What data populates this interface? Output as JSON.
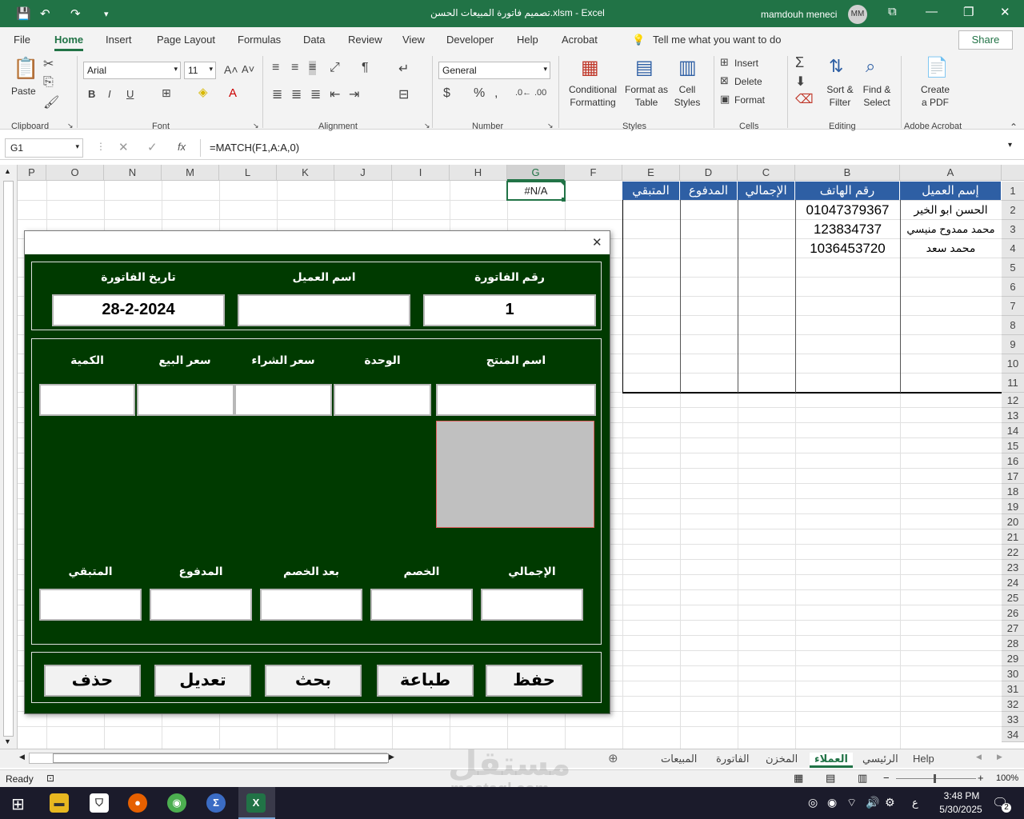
{
  "window": {
    "title": "تصميم فاتورة المبيعات الحسن.xlsm  -  Excel",
    "user": "mamdouh meneci",
    "avatar": "MM"
  },
  "menu": {
    "tabs": [
      "File",
      "Home",
      "Insert",
      "Page Layout",
      "Formulas",
      "Data",
      "Review",
      "View",
      "Developer",
      "Help",
      "Acrobat"
    ],
    "tell_me": "Tell me what you want to do",
    "share": "Share"
  },
  "ribbon": {
    "paste": "Paste",
    "clipboard": "Clipboard",
    "font_name": "Arial",
    "font_size": "11",
    "font": "Font",
    "alignment": "Alignment",
    "number_format": "General",
    "number": "Number",
    "conditional_formatting": "Conditional Formatting",
    "format_as_table": "Format as Table",
    "cell_styles": "Cell Styles",
    "styles": "Styles",
    "insert": "Insert",
    "delete": "Delete",
    "format": "Format",
    "cells": "Cells",
    "sort_filter": "Sort & Filter",
    "find_select": "Find & Select",
    "editing": "Editing",
    "create_pdf": "Create a PDF",
    "adobe_acrobat": "Adobe Acrobat"
  },
  "formula_bar": {
    "name_box": "G1",
    "fx": "fx",
    "formula": "=MATCH(F1,A:A,0)"
  },
  "sheet": {
    "columns": [
      "P",
      "O",
      "N",
      "M",
      "L",
      "K",
      "J",
      "I",
      "H",
      "G",
      "F",
      "E",
      "D",
      "C",
      "B",
      "A"
    ],
    "rows": [
      "1",
      "2",
      "3",
      "4",
      "5",
      "6",
      "7",
      "8",
      "9",
      "10",
      "11",
      "12",
      "13",
      "14",
      "15",
      "16",
      "17",
      "18",
      "19",
      "20",
      "21",
      "22",
      "23",
      "24",
      "25",
      "26",
      "27",
      "28",
      "29",
      "30",
      "31",
      "32",
      "33",
      "34"
    ],
    "g1_value": "#N/A",
    "table_headers": [
      "المتبقي",
      "المدفوع",
      "الإجمالي",
      "رقم الهاتف",
      "إسم العميل"
    ],
    "table_rows": [
      {
        "phone": "01047379367",
        "name": "الحسن ابو الخير"
      },
      {
        "phone": "123834737",
        "name": "محمد ممدوح منيسي"
      },
      {
        "phone": "1036453720",
        "name": "محمد سعد"
      }
    ]
  },
  "dialog": {
    "close": "✕",
    "labels": {
      "invoice_no": "رقم الفاتورة",
      "customer_name": "اسم العميل",
      "invoice_date": "تاريخ الفاتورة",
      "product_name": "اسم المنتج",
      "unit": "الوحدة",
      "purchase_price": "سعر الشراء",
      "sale_price": "سعر البيع",
      "quantity": "الكمية",
      "total": "الإجمالي",
      "discount": "الخصم",
      "after_discount": "بعد الخصم",
      "paid": "المدفوع",
      "remaining": "المتبقي"
    },
    "values": {
      "invoice_no": "1",
      "customer_name": "",
      "invoice_date": "28-2-2024"
    },
    "buttons": {
      "save": "حفظ",
      "print": "طباعة",
      "search": "بحث",
      "edit": "تعديل",
      "delete": "حذف"
    }
  },
  "sheet_tabs": [
    "Help",
    "الرئيسي",
    "العملاء",
    "المخزن",
    "الفاتورة",
    "المبيعات"
  ],
  "active_sheet": "العملاء",
  "status": {
    "ready": "Ready",
    "zoom": "100%"
  },
  "taskbar": {
    "time": "3:48 PM",
    "date": "5/30/2025",
    "lang": "ع",
    "notifications": "2"
  },
  "watermark": {
    "text": "مستقل",
    "site": "mostaql.com"
  },
  "colors": {
    "excel_green": "#217346",
    "dialog_bg": "#003a00",
    "header_blue": "#2e5fa4"
  }
}
